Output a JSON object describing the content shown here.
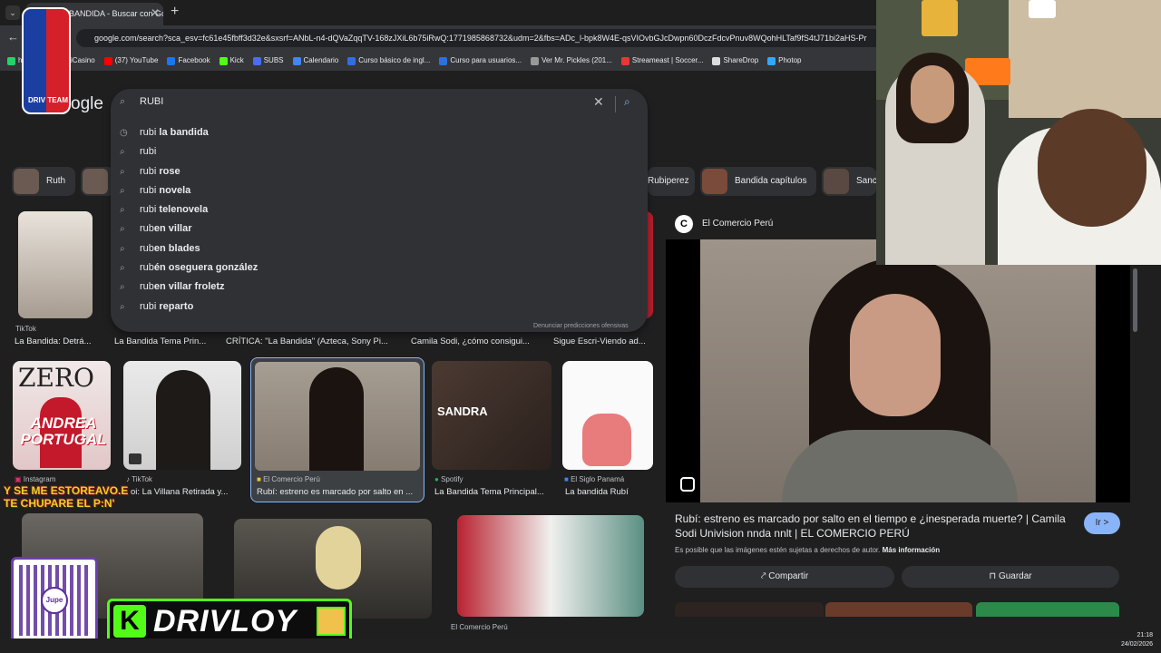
{
  "browser": {
    "tab_title": "BANDIDA - Buscar con Google",
    "tab_close": "✕",
    "new_tab": "+",
    "back": "←",
    "url": "google.com/search?sca_esv=fc61e45fbff3d32e&sxsrf=ANbL-n4-dQVaZqqTV-168zJXiL6b75iRwQ:1771985868732&udm=2&fbs=ADc_l-bpk8W4E-qsVIOvbGJcDwpn60DczFdcvPnuv8WQohHLTaf9fS4tJ71bi2aHS-Pr"
  },
  "bookmarks": [
    {
      "label": "hatsApp",
      "color": "#25d366"
    },
    {
      "label": "MiCasino",
      "color": "#f4c430"
    },
    {
      "label": "(37) YouTube",
      "color": "#ff0000"
    },
    {
      "label": "Facebook",
      "color": "#1877f2"
    },
    {
      "label": "Kick",
      "color": "#53fc18"
    },
    {
      "label": "SUBS",
      "color": "#4a6cf7"
    },
    {
      "label": "Calendario",
      "color": "#4285f4"
    },
    {
      "label": "Curso básico de ingl...",
      "color": "#2f6fe0"
    },
    {
      "label": "Curso para usuarios...",
      "color": "#2f6fe0"
    },
    {
      "label": "Ver Mr. Pickles (201...",
      "color": "#999999"
    },
    {
      "label": "Streameast | Soccer...",
      "color": "#e53935"
    },
    {
      "label": "ShareDrop",
      "color": "#dddddd"
    },
    {
      "label": "Photop",
      "color": "#31a8ff"
    }
  ],
  "logo_overlay": {
    "text": "DRIV TEAM"
  },
  "google_logo": "ogle",
  "search": {
    "query": "RUBI",
    "clear_icon": "✕",
    "report": "Denunciar predicciones ofensivas",
    "suggestions": [
      {
        "prefix": "rubi",
        "rest": " la bandida",
        "icon": "◷"
      },
      {
        "prefix": "rubi",
        "rest": "",
        "icon": "⌕"
      },
      {
        "prefix": "rubi",
        "rest": " rose",
        "icon": "⌕"
      },
      {
        "prefix": "rubi",
        "rest": " novela",
        "icon": "⌕"
      },
      {
        "prefix": "rubi",
        "rest": " telenovela",
        "icon": "⌕"
      },
      {
        "prefix": "rub",
        "rest": "en villar",
        "icon": "⌕"
      },
      {
        "prefix": "rub",
        "rest": "en blades",
        "icon": "⌕"
      },
      {
        "prefix": "rub",
        "rest": "én oseguera gonzález",
        "icon": "⌕"
      },
      {
        "prefix": "rub",
        "rest": "en villar froletz",
        "icon": "⌕"
      },
      {
        "prefix": "rubi",
        "rest": " reparto",
        "icon": "⌕"
      }
    ]
  },
  "chips": [
    {
      "label": "Ruth"
    },
    {
      "label": ""
    },
    {
      "label": "Rubiperez"
    },
    {
      "label": "Bandida capítulos"
    },
    {
      "label": "Sanc"
    }
  ],
  "row1": [
    {
      "source": "TikTok",
      "caption": "La Bandida: Detrá..."
    },
    {
      "source": "",
      "caption": "La Bandida Tema Prin..."
    },
    {
      "source": "",
      "caption": "CRÍTICA: \"La Bandida\" (Azteca, Sony Pi..."
    },
    {
      "source": "",
      "caption": "Camila Sodi, ¿cómo consigui..."
    },
    {
      "source": "",
      "caption": "Sigue Escri-Viendo ad..."
    }
  ],
  "row2": [
    {
      "source": "Instagram",
      "caption": "",
      "overlay": "ANDREA PORTUGAL",
      "brand": "ZERO"
    },
    {
      "source": "TikTok",
      "caption": "oi: La Villana Retirada y..."
    },
    {
      "source": "El Comercio Perú",
      "caption": "Rubí: estreno es marcado por salto en ..."
    },
    {
      "source": "Spotify",
      "caption": "La Bandida Tema Principal...",
      "overlay": "SANDRA"
    },
    {
      "source": "El Siglo Panamá",
      "caption": "La bandida Rubí"
    }
  ],
  "row3_source": "El Comercio Perú",
  "panel": {
    "source": "El Comercio Perú",
    "source_initial": "C",
    "title": "Rubí: estreno es marcado por salto en el tiempo e ¿inesperada muerte? | Camila Sodi Univision nnda nnlt | EL COMERCIO PERÚ",
    "go": "Ir >",
    "copyright": "Es posible que las imágenes estén sujetas a derechos de autor.",
    "more_info": "Más información",
    "share": "Compartir",
    "save": "Guardar"
  },
  "stream": {
    "overlay_text_1": "Y SE ME ESTOREAVO.E",
    "overlay_text_2": "TE CHUPARE  EL P:N'",
    "qr_label": "Jupe",
    "kick_letter": "K",
    "kick_name": "DRIVLOY"
  },
  "clock": {
    "time": "21:18",
    "date": "24/02/2026"
  }
}
